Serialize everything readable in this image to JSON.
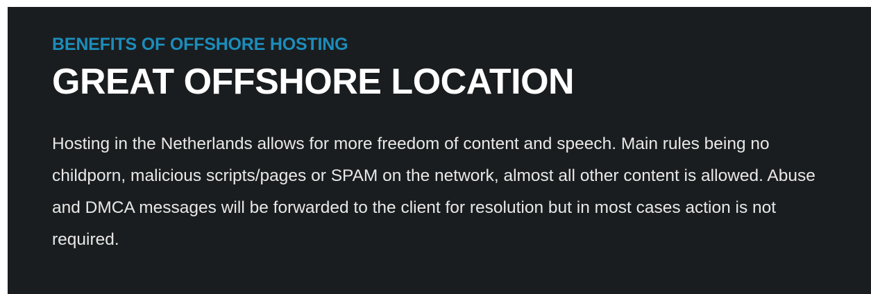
{
  "section": {
    "eyebrow": "BENEFITS OF OFFSHORE HOSTING",
    "headline": "GREAT OFFSHORE LOCATION",
    "body": "Hosting in the Netherlands allows for more freedom of content and speech. Main rules being no childporn, malicious scripts/pages or SPAM on the network, almost all other content is allowed. Abuse and DMCA messages will be forwarded to the client for resolution but in most cases action is not required."
  },
  "colors": {
    "background": "#1a1d1f",
    "accent": "#1c8dbb",
    "headline": "#ffffff",
    "body": "#e8e8e8"
  }
}
